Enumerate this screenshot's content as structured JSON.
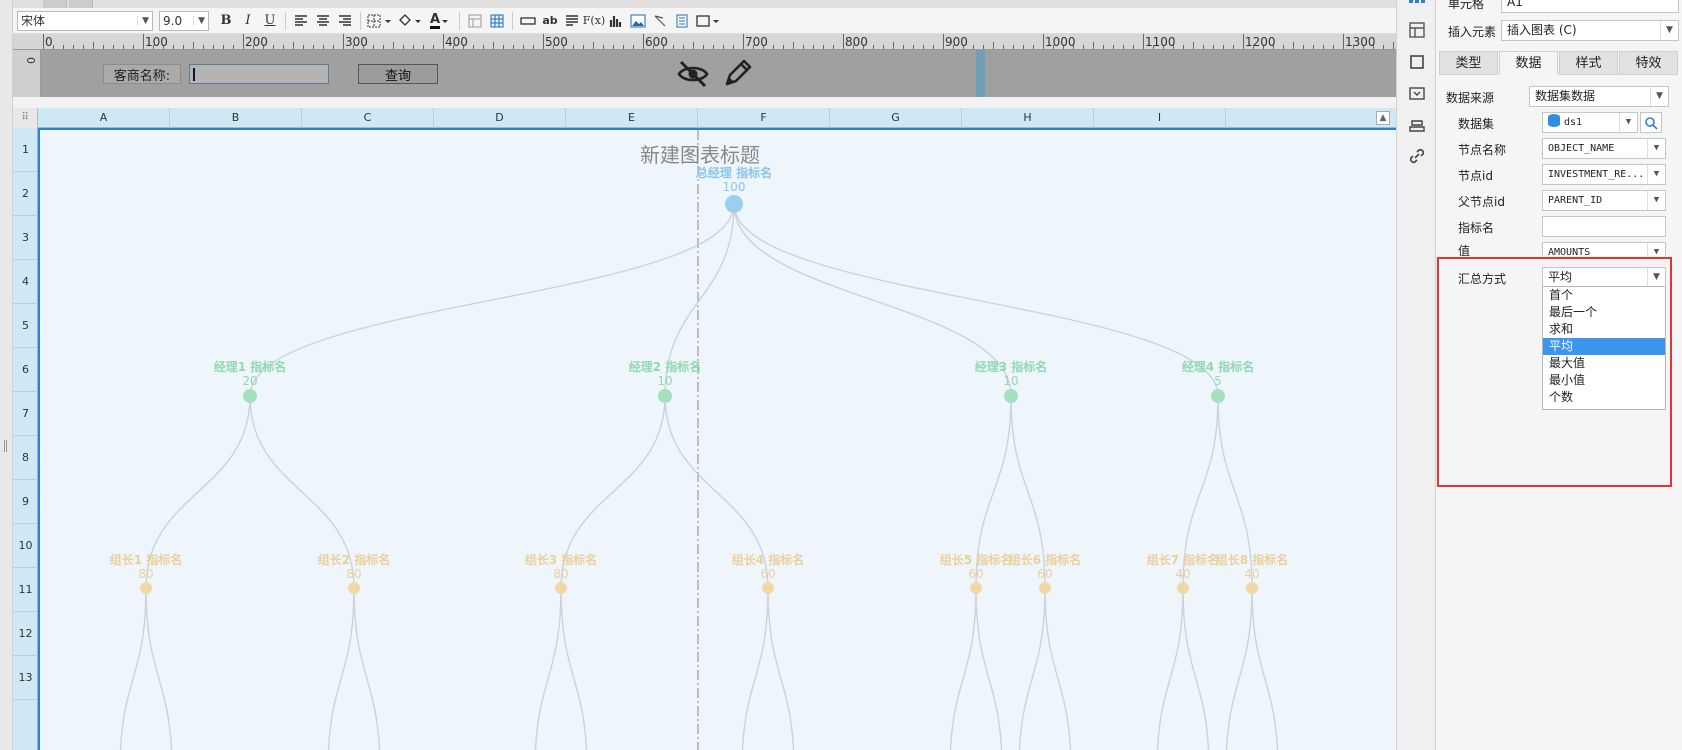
{
  "toolbar": {
    "font_family": "宋体",
    "font_size": "9.0",
    "bold": "B",
    "italic": "I",
    "underline": "U",
    "font_color_glyph": "A",
    "text_glyph": "ab",
    "formula_glyph": "F(x)"
  },
  "ruler": {
    "labels": [
      "0",
      "100",
      "200",
      "300",
      "400",
      "500",
      "600",
      "700",
      "800",
      "900",
      "1000",
      "1100",
      "1200",
      "1300"
    ],
    "vertical_zero": "0"
  },
  "param_panel": {
    "label": "客商名称:",
    "input_value": "",
    "query_label": "查询"
  },
  "sheet": {
    "columns": [
      "A",
      "B",
      "C",
      "D",
      "E",
      "F",
      "G",
      "H",
      "I"
    ],
    "rows": [
      "1",
      "2",
      "3",
      "4",
      "5",
      "6",
      "7",
      "8",
      "9",
      "10",
      "11",
      "12",
      "13"
    ]
  },
  "chart_data": {
    "type": "tree",
    "title": "新建图表标题",
    "metric_label": "指标名",
    "root": {
      "name": "总经理",
      "value": 100
    },
    "level1": [
      {
        "name": "经理1",
        "value": 20
      },
      {
        "name": "经理2",
        "value": 10
      },
      {
        "name": "经理3",
        "value": 10
      },
      {
        "name": "经理4",
        "value": 5
      }
    ],
    "level2": [
      {
        "name": "组长1",
        "value": 80,
        "parent": 0
      },
      {
        "name": "组长2",
        "value": 80,
        "parent": 0
      },
      {
        "name": "组长3",
        "value": 80,
        "parent": 1
      },
      {
        "name": "组长4",
        "value": 60,
        "parent": 1
      },
      {
        "name": "组长5",
        "value": 60,
        "parent": 2
      },
      {
        "name": "组长6",
        "value": 60,
        "parent": 2
      },
      {
        "name": "组长7",
        "value": 40,
        "parent": 3
      },
      {
        "name": "组长8",
        "value": 40,
        "parent": 3
      }
    ],
    "colors": {
      "root": "#9ccfef",
      "level1": "#a6e0bf",
      "level2": "#f1d8a6",
      "link": "#c9d3da"
    }
  },
  "properties": {
    "cell_label": "单元格",
    "cell_value": "A1",
    "insert_label": "插入元素",
    "insert_value": "插入图表 (C)",
    "tabs": [
      "类型",
      "数据",
      "样式",
      "特效"
    ],
    "active_tab": "数据",
    "data_source_label": "数据来源",
    "data_source_value": "数据集数据",
    "dataset_label": "数据集",
    "dataset_value": "ds1",
    "node_name_label": "节点名称",
    "node_name_value": "OBJECT_NAME",
    "node_id_label": "节点id",
    "node_id_value": "INVESTMENT_RE...",
    "parent_id_label": "父节点id",
    "parent_id_value": "PARENT_ID",
    "metric_label": "指标名",
    "metric_value": "",
    "value_label": "值",
    "value_value": "AMOUNTS",
    "summary_label": "汇总方式",
    "summary_value": "平均",
    "summary_options": [
      "首个",
      "最后一个",
      "求和",
      "平均",
      "最大值",
      "最小值",
      "个数"
    ],
    "summary_selected_index": 3
  }
}
